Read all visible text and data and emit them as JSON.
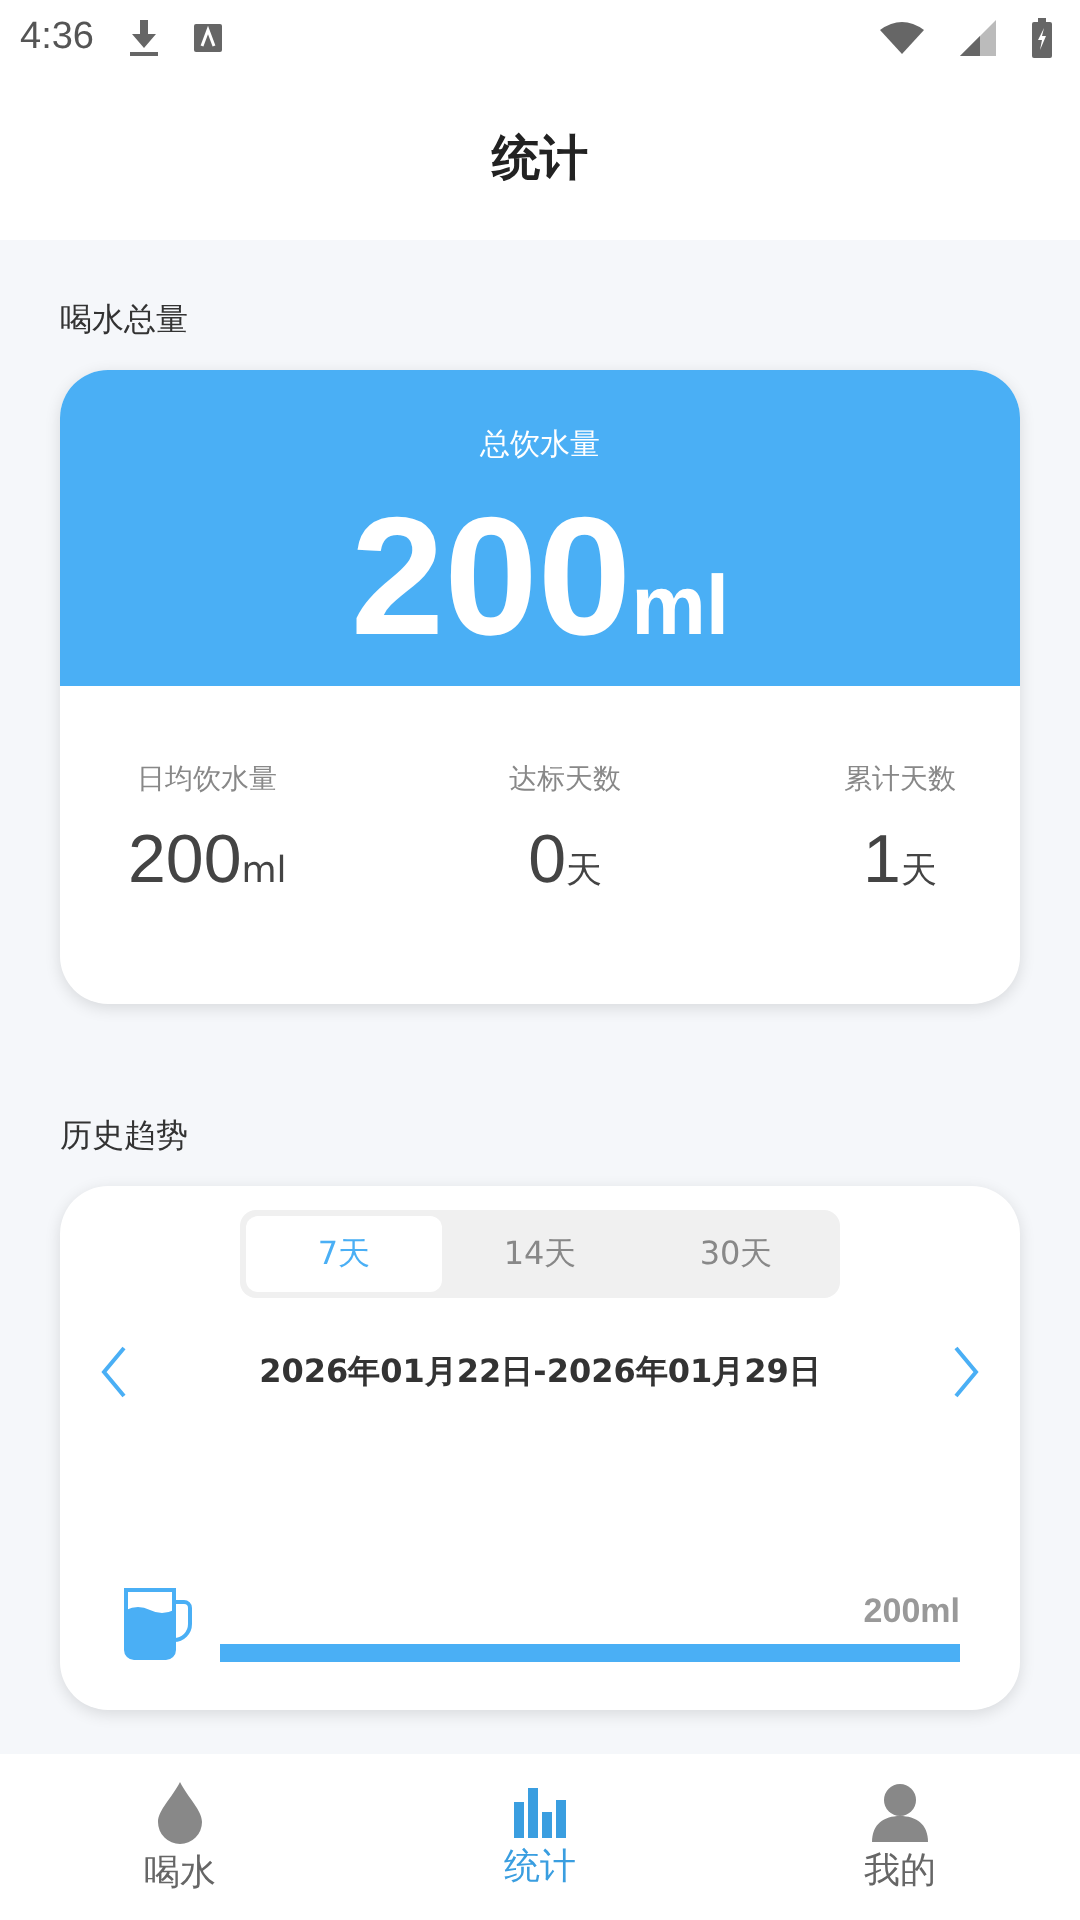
{
  "status_bar": {
    "time": "4:36"
  },
  "header": {
    "title": "统计"
  },
  "total_section": {
    "label": "喝水总量",
    "card_title": "总饮水量",
    "total_value": "200",
    "total_unit": "ml",
    "stats": [
      {
        "label": "日均饮水量",
        "value": "200",
        "unit": "ml"
      },
      {
        "label": "达标天数",
        "value": "0",
        "unit": "天"
      },
      {
        "label": "累计天数",
        "value": "1",
        "unit": "天"
      }
    ]
  },
  "history_section": {
    "label": "历史趋势",
    "tabs": [
      {
        "label": "7天",
        "selected": true
      },
      {
        "label": "14天",
        "selected": false
      },
      {
        "label": "30天",
        "selected": false
      }
    ],
    "date_range": "2026年01月22日-2026年01月29日",
    "bar": {
      "reading": "200ml"
    }
  },
  "bottom_nav": [
    {
      "kind": "drop",
      "label": "喝水",
      "selected": false
    },
    {
      "kind": "chart",
      "label": "统计",
      "selected": true
    },
    {
      "kind": "person",
      "label": "我的",
      "selected": false
    }
  ]
}
